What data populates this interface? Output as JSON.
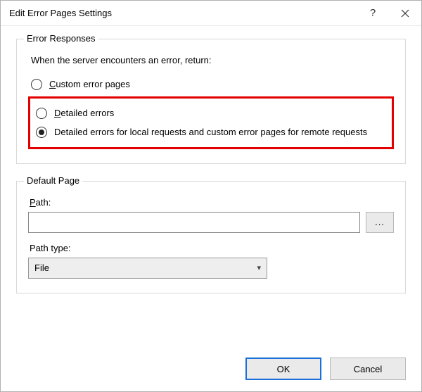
{
  "window": {
    "title": "Edit Error Pages Settings"
  },
  "errorResponses": {
    "legend": "Error Responses",
    "instruction": "When the server encounters an error, return:",
    "options": {
      "custom": {
        "prefix": "C",
        "rest": "ustom error pages",
        "selected": false
      },
      "detailed": {
        "prefix": "D",
        "rest": "etailed errors",
        "selected": false
      },
      "hybrid": {
        "text": "Detailed errors for local requests and custom error pages for remote requests",
        "selected": true
      }
    }
  },
  "defaultPage": {
    "legend": "Default Page",
    "pathLabelPrefix": "P",
    "pathLabelRest": "ath:",
    "pathValue": "",
    "browseLabel": "...",
    "pathTypeLabel": "Path type:",
    "pathTypeValue": "File"
  },
  "buttons": {
    "ok": "OK",
    "cancel": "Cancel"
  }
}
